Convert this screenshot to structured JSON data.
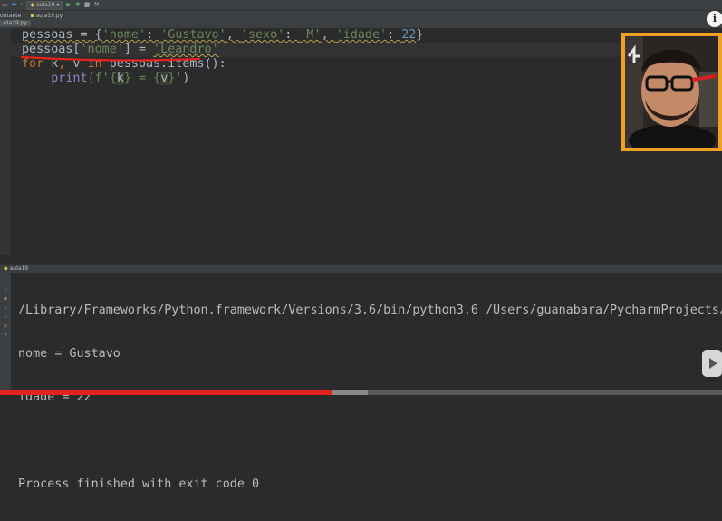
{
  "toolbar": {
    "run_config_label": "aula19",
    "icons": [
      "add-icon",
      "run-icon",
      "debug-icon",
      "stop-icon",
      "build-icon"
    ]
  },
  "tabs": [
    {
      "label": "ontante",
      "icon": "folder-icon"
    },
    {
      "label": "aula19.py",
      "icon": "python-file-icon"
    }
  ],
  "editor": {
    "file_tab_label": "ula19.py",
    "lines": [
      [
        {
          "t": "pessoas = {",
          "c": "plain warn"
        },
        {
          "t": "'nome'",
          "c": "str warn"
        },
        {
          "t": ": ",
          "c": "plain warn"
        },
        {
          "t": "'Gustavo'",
          "c": "str warn"
        },
        {
          "t": ", ",
          "c": "plain warn"
        },
        {
          "t": "'sexo'",
          "c": "str warn"
        },
        {
          "t": ": ",
          "c": "plain warn"
        },
        {
          "t": "'M'",
          "c": "str warn"
        },
        {
          "t": ", ",
          "c": "plain warn"
        },
        {
          "t": "'idade'",
          "c": "str warn"
        },
        {
          "t": ": ",
          "c": "plain warn"
        },
        {
          "t": "22",
          "c": "num warn"
        },
        {
          "t": "}",
          "c": "plain"
        }
      ],
      [
        {
          "t": "pessoas[",
          "c": "plain"
        },
        {
          "t": "'nome'",
          "c": "str"
        },
        {
          "t": "] = ",
          "c": "plain"
        },
        {
          "t": "'Leandro'",
          "c": "str warn"
        }
      ],
      [
        {
          "t": "for",
          "c": "kw"
        },
        {
          "t": " k",
          "c": "plain"
        },
        {
          "t": ",",
          "c": "kw"
        },
        {
          "t": " v ",
          "c": "plain"
        },
        {
          "t": "in",
          "c": "kw"
        },
        {
          "t": " pessoas.items():",
          "c": "plain"
        }
      ],
      [
        {
          "t": "    ",
          "c": "plain"
        },
        {
          "t": "print",
          "c": "fn"
        },
        {
          "t": "(f'{",
          "c": "str"
        },
        {
          "t": "k",
          "c": "fvar"
        },
        {
          "t": "} = {",
          "c": "str"
        },
        {
          "t": "v",
          "c": "fvar"
        },
        {
          "t": "}'",
          "c": "str"
        },
        {
          "t": ")",
          "c": "plain"
        }
      ]
    ]
  },
  "console": {
    "run_tab_label": "aula19",
    "lines": [
      "/Library/Frameworks/Python.framework/Versions/3.6/bin/python3.6 /Users/guanabara/PycharmProjects/",
      "nome = Gustavo",
      "idade = 22",
      "",
      "Process finished with exit code 0"
    ]
  },
  "video": {
    "progress_played_pct": 46,
    "progress_loaded_pct": 51,
    "info_label": "i"
  },
  "colors": {
    "keyword": "#cc7832",
    "string": "#6a8759",
    "number": "#6897bb",
    "builtin": "#8888c6",
    "webcam_border": "#f2a024",
    "progress_red": "#e52222"
  }
}
